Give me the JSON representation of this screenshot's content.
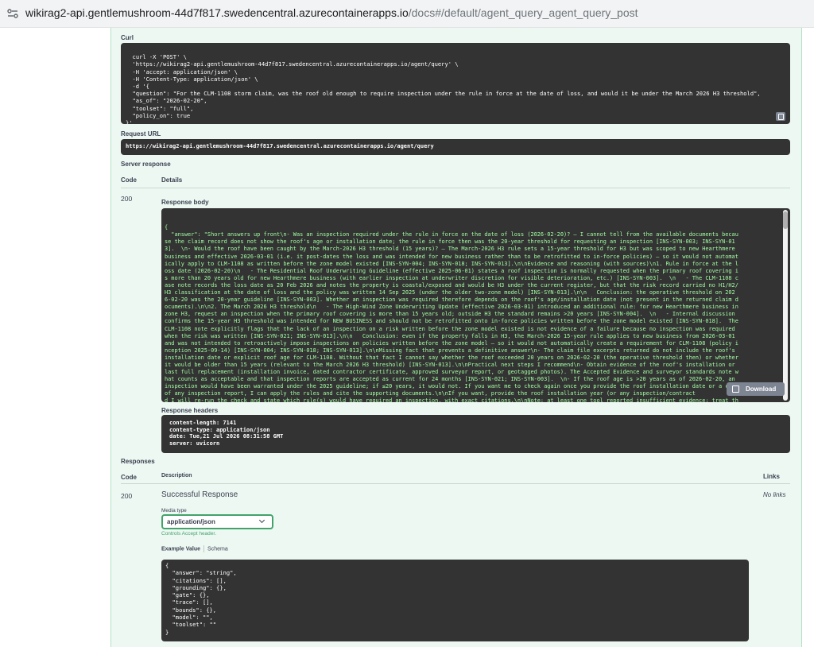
{
  "browser": {
    "url_host": "wikirag2-api.gentlemushroom-44d7f817.swedencentral.azurecontainerapps.io",
    "url_path": "/docs#/default/agent_query_agent_query_post"
  },
  "curl": {
    "label": "Curl",
    "command": "curl -X 'POST' \\\n  'https://wikirag2-api.gentlemushroom-44d7f817.swedencentral.azurecontainerapps.io/agent/query' \\\n  -H 'accept: application/json' \\\n  -H 'Content-Type: application/json' \\\n  -d '{\n  \"question\": \"For the CLM-1108 storm claim, was the roof old enough to require inspection under the rule in force at the date of loss, and would it be under the March 2026 H3 threshold\",\n  \"as_of\": \"2026-02-20\",\n  \"toolset\": \"full\",\n  \"policy_on\": true\n}'"
  },
  "request_url": {
    "label": "Request URL",
    "value": "https://wikirag2-api.gentlemushroom-44d7f817.swedencentral.azurecontainerapps.io/agent/query"
  },
  "server_response": {
    "label": "Server response",
    "col_code": "Code",
    "col_details": "Details",
    "code": "200",
    "body_label": "Response body",
    "body_lines": [
      "{",
      "  \"answer\": \"Short answers up front\\n- Was an inspection required under the rule in force on the date of loss (2026-02-20)? — I cannot tell from the available documents becau",
      "se the claim record does not show the roof's age or installation date; the rule in force then was the 20-year threshold for requesting an inspection [INS-SYN-003; INS-SYN-01",
      "3].  \\n- Would the roof have been caught by the March-2026 H3 threshold (15 years)? — The March-2026 H3 rule sets a 15-year threshold for H3 but was scoped to new Hearthmere",
      "business and effective 2026-03-01 (i.e. it post-dates the loss and was intended for new business rather than to be retrofitted to in-force policies) — so it would not automat",
      "ically apply to CLM-1108 as written before the zone model existed [INS-SYN-004; INS-SYN-018; INS-SYN-013].\\n\\nEvidence and reasoning (with sources)\\n1. Rule in force at the l",
      "oss date (2026-02-20)\\n   - The Residential Roof Underwriting Guideline (effective 2025-06-01) states a roof inspection is normally requested when the primary roof covering i",
      "s more than 20 years old for new Hearthmere business (with earlier inspection at underwriter discretion for visible deterioration, etc.) [INS-SYN-003].  \\n   - The CLM-1108 c",
      "ase note records the loss date as 20 Feb 2026 and notes the property is coastal/exposed and would be H3 under the current register, but that the risk record carried no H1/H2/",
      "H3 classification at the date of loss and the policy was written 14 Sep 2025 (under the older two-zone model) [INS-SYN-013].\\n\\n   Conclusion: the operative threshold on 202",
      "6-02-20 was the 20-year guideline [INS-SYN-003]. Whether an inspection was required therefore depends on the roof's age/installation date (not present in the returned claim d",
      "ocuments).\\n\\n2. The March 2026 H3 threshold\\n   - The High-Wind Zone Underwriting Update (effective 2026-03-01) introduced an additional rule: for new Hearthmere business in",
      "zone H3, request an inspection when the primary roof covering is more than 15 years old; outside H3 the standard remains >20 years [INS-SYN-004].  \\n   - Internal discussion",
      "confirms the 15-year H3 threshold was intended for NEW BUSINESS and should not be retrofitted onto in-force policies written before the zone model existed [INS-SYN-018].  The",
      "CLM-1108 note explicitly flags that the lack of an inspection on a risk written before the zone model existed is not evidence of a failure because no inspection was required",
      "when the risk was written [INS-SYN-021; INS-SYN-013].\\n\\n   Conclusion: even if the property falls in H3, the March-2026 15-year rule applies to new business from 2026-03-01",
      "and was not intended to retroactively impose inspections on policies written before the zone model — so it would not automatically create a requirement for CLM-1108 (policy i",
      "nception 2025-09-14) [INS-SYN-004; INS-SYN-018; INS-SYN-013].\\n\\nMissing fact that prevents a definitive answer\\n- The claim file excerpts returned do not include the roof's",
      "installation date or explicit roof age for CLM-1108. Without that fact I cannot say whether the roof exceeded 20 years on 2026-02-20 (the operative threshold then) or whether",
      "it would be older than 15 years (relevant to the March 2026 H3 threshold) [INS-SYN-013].\\n\\nPractical next steps I recommend\\n- Obtain evidence of the roof's installation or",
      "last full replacement (installation invoice, dated contractor certificate, approved surveyor report, or geotagged photos). The Accepted Evidence and surveyor standards note w",
      "hat counts as acceptable and that inspection reports are accepted as current for 24 months [INS-SYN-021; INS-SYN-003].  \\n- If the roof age is >20 years as of 2026-02-20, an",
      "inspection would have been warranted under the 2025 guideline; if ≤20 years, it would not. If you want me to check again once you provide the roof installation date or a copy",
      "of any inspection report, I can apply the rules and cite the supporting documents.\\n\\nIf you want, provide the roof installation year (or any inspection/contract",
      "d I will re-run the check and state which rule(s) would have required an inspection, with exact citations.\\n\\nNote: at least one tool reported insufficient evidence; treat th"
    ],
    "download_label": "Download",
    "headers_label": "Response headers",
    "headers_lines": [
      "content-length: 7141",
      "content-type: application/json",
      "date: Tue,21 Jul 2026 08:31:58 GMT",
      "server: uvicorn"
    ]
  },
  "responses": {
    "label": "Responses",
    "col_code": "Code",
    "col_description": "Description",
    "col_links": "Links",
    "code": "200",
    "description": "Successful Response",
    "links": "No links",
    "media_type_label": "Media type",
    "media_type_value": "application/json",
    "controls_note": "Controls Accept header.",
    "tab_example": "Example Value",
    "tab_schema": "Schema",
    "example_lines": [
      "{",
      "  \"answer\": \"string\",",
      "  \"citations\": [],",
      "  \"grounding\": {},",
      "  \"gate\": {},",
      "  \"trace\": [],",
      "  \"bounds\": {},",
      "  \"model\": \"\",",
      "  \"toolset\": \"\"",
      "}"
    ]
  },
  "colors": {
    "panel_bg": "#eef8f3",
    "code_bg": "#333333",
    "json_string": "#a2fca2",
    "accent_green": "#41a36a"
  }
}
